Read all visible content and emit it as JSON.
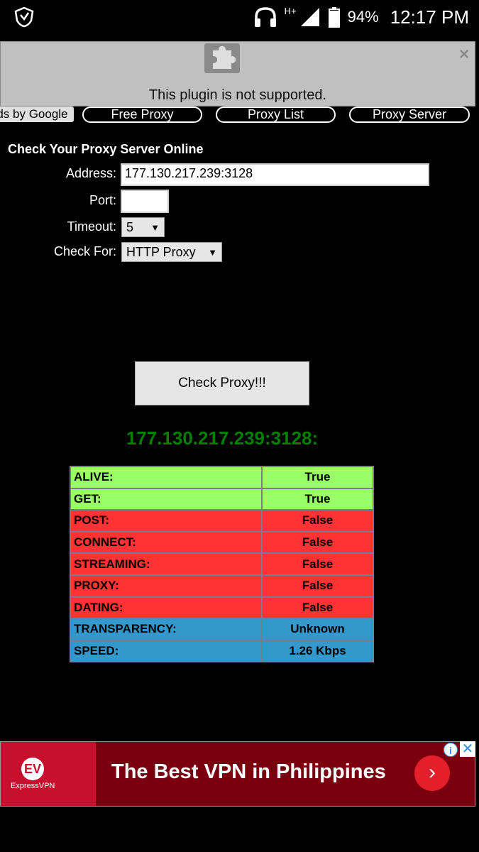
{
  "status_bar": {
    "network_type": "H+",
    "battery": "94%",
    "time": "12:17 PM"
  },
  "plugin": {
    "message": "This plugin is not supported.",
    "close_glyph": "×"
  },
  "nav": {
    "ads_by_google": "Ads by Google",
    "links": [
      "Free Proxy",
      "Proxy List",
      "Proxy Server"
    ]
  },
  "form": {
    "title": "Check Your Proxy Server Online",
    "address_label": "Address:",
    "address_value": "177.130.217.239:3128",
    "port_label": "Port:",
    "port_value": "",
    "timeout_label": "Timeout:",
    "timeout_value": "5",
    "check_for_label": "Check For:",
    "check_for_value": "HTTP Proxy",
    "dropdown_arrow": "▼",
    "check_button": "Check Proxy!!!"
  },
  "result": {
    "title": "177.130.217.239:3128:",
    "rows": [
      {
        "label": "ALIVE:",
        "value": "True",
        "status": "ok"
      },
      {
        "label": "GET:",
        "value": "True",
        "status": "ok"
      },
      {
        "label": "POST:",
        "value": "False",
        "status": "fail"
      },
      {
        "label": "CONNECT:",
        "value": "False",
        "status": "fail"
      },
      {
        "label": "STREAMING:",
        "value": "False",
        "status": "fail"
      },
      {
        "label": "PROXY:",
        "value": "False",
        "status": "fail"
      },
      {
        "label": "DATING:",
        "value": "False",
        "status": "fail"
      },
      {
        "label": "TRANSPARENCY:",
        "value": "Unknown",
        "status": "info"
      },
      {
        "label": "SPEED:",
        "value": "1.26 Kbps",
        "status": "info"
      }
    ]
  },
  "ad": {
    "brand": "ExpressVPN",
    "brand_mark": "EV",
    "headline": "The Best VPN in Philippines",
    "go_glyph": "›",
    "info_glyph": "i",
    "close_glyph": "✕"
  },
  "colors": {
    "ok": "#99ff66",
    "fail": "#ff3333",
    "info": "#3399cc",
    "result_title": "#007f00"
  }
}
